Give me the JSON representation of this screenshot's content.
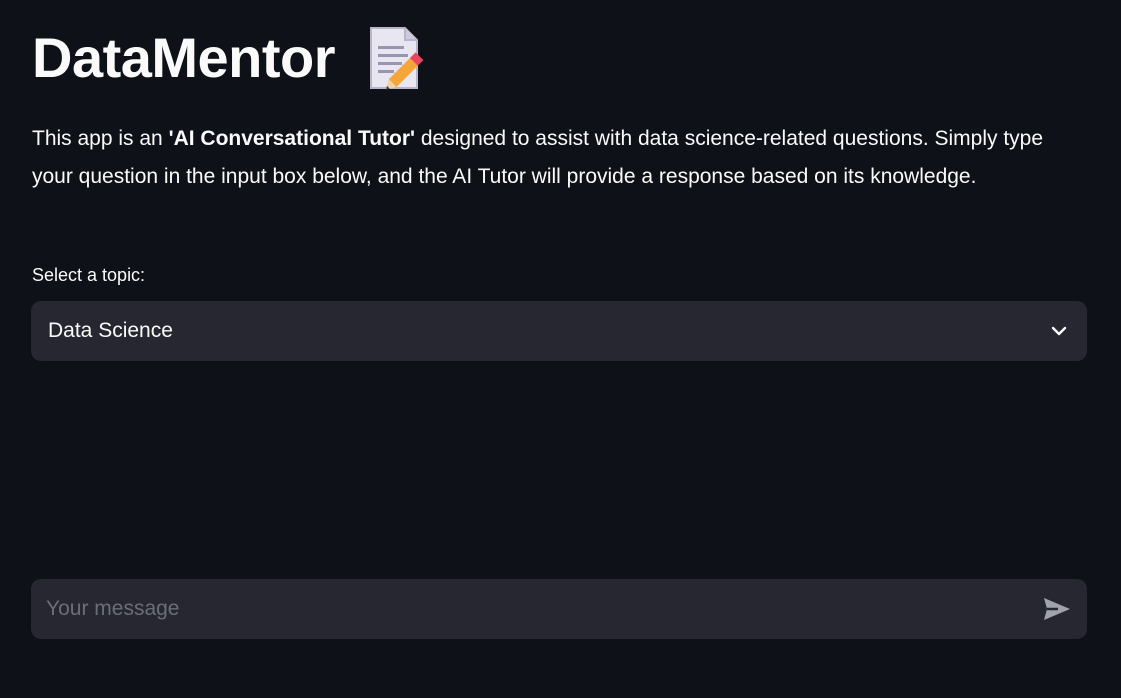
{
  "header": {
    "title": "DataMentor",
    "title_icon": "memo-pencil-icon"
  },
  "intro": {
    "text_before": "This app is an ",
    "bold": "'AI Conversational Tutor'",
    "text_after": " designed to assist with data science-related questions. Simply type your question in the input box below, and the AI Tutor will provide a response based on its knowledge."
  },
  "topic_select": {
    "label": "Select a topic:",
    "selected": "Data Science",
    "icon": "chevron-down-icon"
  },
  "chat": {
    "placeholder": "Your message",
    "send_icon": "send-icon"
  },
  "colors": {
    "background": "#0e1117",
    "widget_background": "#262730",
    "text": "#fafafa",
    "placeholder": "#6b6e78"
  }
}
